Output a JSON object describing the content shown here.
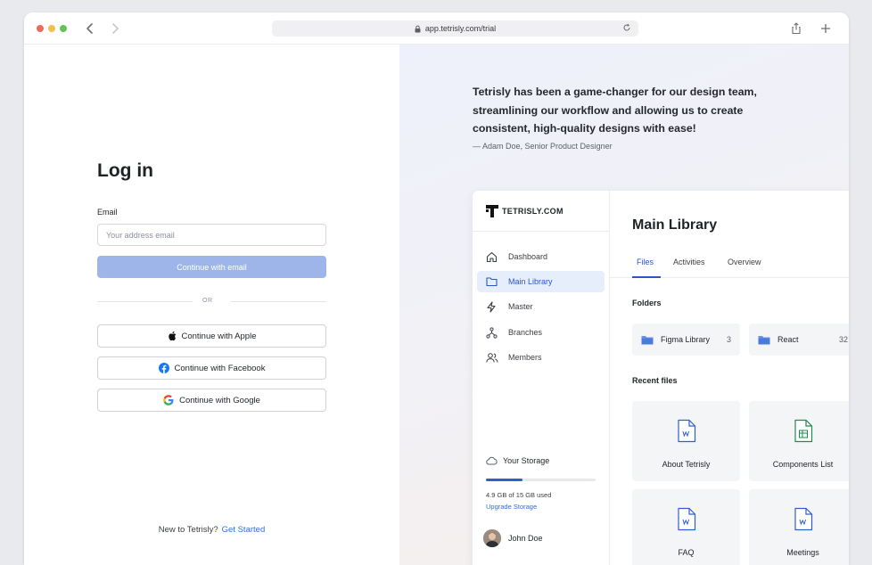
{
  "browser": {
    "url": "app.tetrisly.com/trial"
  },
  "login": {
    "title": "Log in",
    "email_label": "Email",
    "email_placeholder": "Your address email",
    "email_value": "",
    "continue_email": "Continue with email",
    "or": "OR",
    "apple": "Continue with Apple",
    "facebook": "Continue with Facebook",
    "google": "Continue with Google",
    "new_user": "New to Tetrisly?",
    "get_started": "Get Started"
  },
  "testimonial": {
    "quote": "Tetrisly has been a game-changer for our design team, streamlining our workflow and allowing us to create consistent, high-quality designs with ease!",
    "author": "— Adam Doe, Senior Product Designer"
  },
  "preview": {
    "brand": "TETRISLY.COM",
    "sidebar": [
      {
        "label": "Dashboard",
        "icon": "home-icon",
        "active": false
      },
      {
        "label": "Main Library",
        "icon": "folder-icon",
        "active": true
      },
      {
        "label": "Master",
        "icon": "bolt-icon",
        "active": false
      },
      {
        "label": "Branches",
        "icon": "branches-icon",
        "active": false
      },
      {
        "label": "Members",
        "icon": "members-icon",
        "active": false
      }
    ],
    "storage": {
      "title": "Your Storage",
      "used_text": "4.9 GB of 15 GB used",
      "fraction": 0.33,
      "upgrade": "Upgrade Storage"
    },
    "user": {
      "name": "John Doe"
    },
    "main": {
      "title": "Main Library",
      "tabs": [
        "Files",
        "Activities",
        "Overview"
      ],
      "active_tab": "Files",
      "folders_label": "Folders",
      "folders": [
        {
          "name": "Figma Library",
          "count": "3"
        },
        {
          "name": "React",
          "count": "32"
        }
      ],
      "recent_label": "Recent files",
      "files": [
        {
          "name": "About Tetrisly",
          "type": "word",
          "color": "#2f5fcf"
        },
        {
          "name": "Components List",
          "type": "sheet",
          "color": "#1f8a4c"
        },
        {
          "name": "FAQ",
          "type": "word",
          "color": "#2f5fcf"
        },
        {
          "name": "Meetings",
          "type": "word",
          "color": "#2f5fcf"
        }
      ]
    }
  },
  "colors": {
    "accent": "#2659c4",
    "button_disabled": "#9db5e8",
    "link": "#2f6fd8"
  }
}
